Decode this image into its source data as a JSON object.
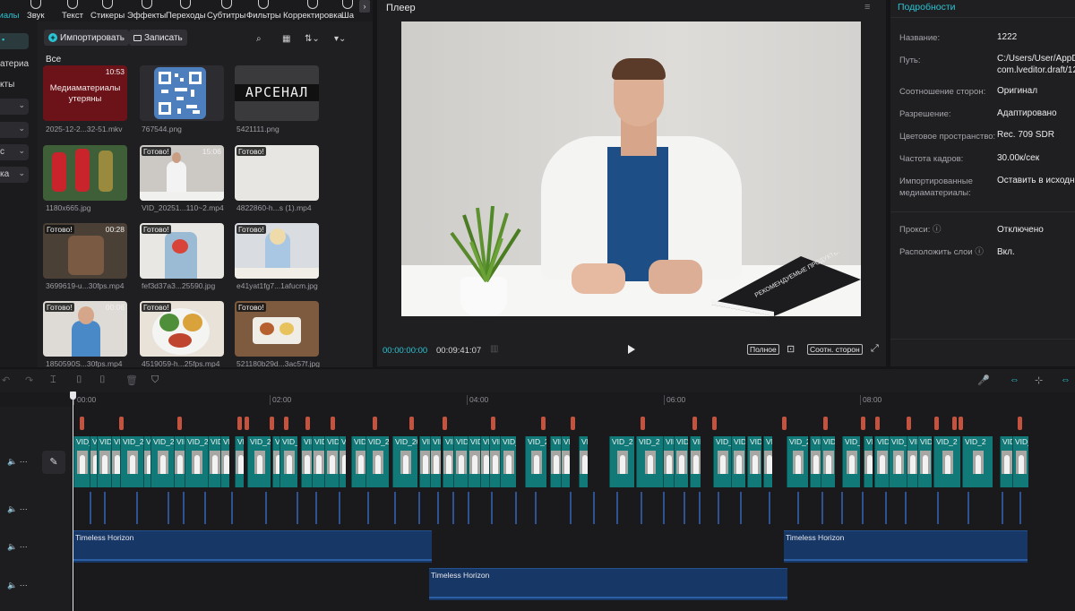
{
  "toolbar": {
    "tabs": [
      {
        "label": "Звук",
        "icon": "sound-icon"
      },
      {
        "label": "Текст",
        "icon": "text-icon"
      },
      {
        "label": "Стикеры",
        "icon": "sticker-icon"
      },
      {
        "label": "Эффекты",
        "icon": "effects-icon"
      },
      {
        "label": "Переходы",
        "icon": "transitions-icon"
      },
      {
        "label": "Субтитры",
        "icon": "subtitles-icon"
      },
      {
        "label": "Фильтры",
        "icon": "filters-icon"
      },
      {
        "label": "Корректировка",
        "icon": "adjust-icon"
      },
      {
        "label": "Ша",
        "icon": "templates-icon"
      }
    ],
    "active_label": "иалы",
    "more": "›"
  },
  "leftnav": {
    "items": [
      "атериа",
      "кты"
    ],
    "dropdowns": [
      "",
      "",
      "с",
      "ка"
    ]
  },
  "media": {
    "import_label": "Импортировать",
    "record_label": "Записать",
    "section": "Все",
    "items": [
      {
        "name": "2025-12-2...32-51.mkv",
        "status": "",
        "duration": "10:53",
        "note": "Медиаматериалы утеряны"
      },
      {
        "name": "767544.png",
        "status": "",
        "duration": "",
        "note": ""
      },
      {
        "name": "5421111.png",
        "status": "",
        "duration": "",
        "note": "АРСЕНАЛ"
      },
      {
        "name": "1180x665.jpg",
        "status": "",
        "duration": "",
        "note": ""
      },
      {
        "name": "VID_20251...110~2.mp4",
        "status": "Готово!",
        "duration": "15:06",
        "note": ""
      },
      {
        "name": "4822860-h...s (1).mp4",
        "status": "Готово!",
        "duration": "",
        "note": ""
      },
      {
        "name": "3699619-u...30fps.mp4",
        "status": "Готово!",
        "duration": "00:28",
        "note": ""
      },
      {
        "name": "fef3d37a3...25590.jpg",
        "status": "Готово!",
        "duration": "",
        "note": ""
      },
      {
        "name": "e41yat1fg7...1afucm.jpg",
        "status": "Готово!",
        "duration": "",
        "note": ""
      },
      {
        "name": "1850590S...30fps.mp4",
        "status": "Готово!",
        "duration": "00:06",
        "note": ""
      },
      {
        "name": "4519059-h...25fps.mp4",
        "status": "Готово!",
        "duration": "",
        "note": ""
      },
      {
        "name": "521180b29d...3ac57f.jpg",
        "status": "Готово!",
        "duration": "",
        "note": ""
      }
    ]
  },
  "player": {
    "title": "Плеер",
    "current_time": "00:00:00:00",
    "duration": "00:09:41:07",
    "full_label": "Полное",
    "ratio_label": "Соотн. сторон",
    "book_text": "РЕКОМЕНДУЕМЫЕ ПРОДУКТЫ ПИТАНИЯ"
  },
  "details": {
    "title": "Подробности",
    "rows": [
      {
        "key": "Название:",
        "value": "1222"
      },
      {
        "key": "Путь:",
        "value": "C:/Users/User/AppD\ncom.lveditor.draft/12"
      },
      {
        "key": "Соотношение сторон:",
        "value": "Оригинал"
      },
      {
        "key": "Разрешение:",
        "value": "Адаптировано"
      },
      {
        "key": "Цветовое пространство:",
        "value": "Rec. 709 SDR"
      },
      {
        "key": "Частота кадров:",
        "value": "30.00к/сек"
      },
      {
        "key": "Импортированные медиаматериалы:",
        "value": "Оставить в исходн"
      },
      {
        "key": "Прокси:",
        "value": "Отключено"
      },
      {
        "key": "Расположить слои",
        "value": "Вкл."
      }
    ]
  },
  "timeline": {
    "ticks": [
      "00:00",
      "02:00",
      "04:00",
      "06:00",
      "08:00"
    ],
    "clip_label": "VID_2",
    "clip_label_long": "VID_20",
    "audio_label": "Timeless Horizon",
    "colors": {
      "accent": "#2ac4d3",
      "video": "#117a78",
      "audio": "#173767",
      "marker": "#c3533e"
    }
  }
}
